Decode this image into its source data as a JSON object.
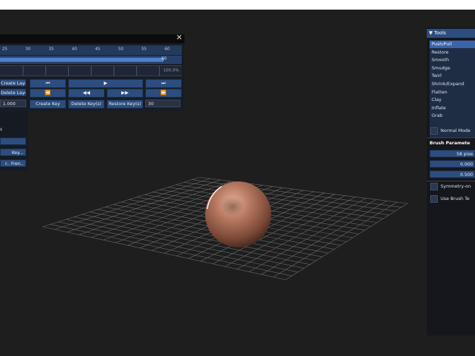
{
  "animation_panel": {
    "close_glyph": "✕",
    "ruler_ticks": [
      "25",
      "30",
      "35",
      "40",
      "45",
      "50",
      "55",
      "60"
    ],
    "progress_value": "60",
    "progress_fraction": 0.9,
    "track_end_value": "100.0%",
    "row1": {
      "create_layer_label": "Create Layer",
      "first_frame_icon": "⏮",
      "play_icon": "▶",
      "last_frame_icon": "⏭"
    },
    "row2": {
      "delete_layer_label": "Delete Layer",
      "prev_key_icon": "⏪",
      "step_back_icon": "◀◀",
      "step_fwd_icon": "▶▶",
      "next_key_icon": "⏩"
    },
    "row3": {
      "speed_value": "1.000",
      "create_key_label": "Create Key",
      "delete_key_label": "Delete Key(s)",
      "restore_key_label": "Restore Key(s)",
      "frame_value": "30"
    }
  },
  "layer_panel": {
    "header": "s",
    "button1": "",
    "button2": "Key...",
    "button3": "r.. Fren.."
  },
  "tools_panel": {
    "title": "▼ Tools",
    "items": [
      {
        "label": "Push/Pull",
        "selected": true
      },
      {
        "label": "Restore",
        "selected": false
      },
      {
        "label": "Smooth",
        "selected": false
      },
      {
        "label": "Smudge",
        "selected": false
      },
      {
        "label": "Twirl",
        "selected": false
      },
      {
        "label": "Shrink/Expand",
        "selected": false
      },
      {
        "label": "Flatten",
        "selected": false
      },
      {
        "label": "Clay",
        "selected": false
      },
      {
        "label": "Inflate",
        "selected": false
      },
      {
        "label": "Grab",
        "selected": false
      }
    ],
    "normal_mode_label": "Normal Mode",
    "brush_params_label": "Brush Paramete",
    "brush_size": "58 pixe",
    "brush_strength": "0.000",
    "brush_falloff": "0.500",
    "symmetry_label": "Symmetry-on",
    "use_brush_texture_label": "Use Brush Te"
  },
  "colors": {
    "background": "#1e1e1e",
    "panel": "#181c24",
    "button_blue": "#2c4d7e",
    "selection_blue": "#3a64a8",
    "sphere": "#a8715a"
  }
}
